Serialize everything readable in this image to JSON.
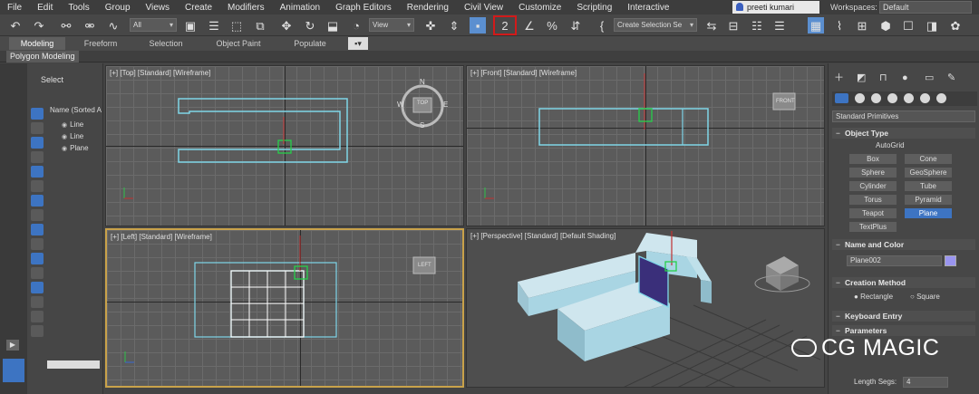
{
  "menu": [
    "File",
    "Edit",
    "Tools",
    "Group",
    "Views",
    "Create",
    "Modifiers",
    "Animation",
    "Graph Editors",
    "Rendering",
    "Civil View",
    "Customize",
    "Scripting",
    "Interactive"
  ],
  "user": "preeti kumari",
  "workspace_label": "Workspaces:",
  "workspace_value": "Default",
  "toolbar": {
    "selection_filter": "All",
    "reference_coord": "View",
    "named_selection": "Create Selection Se"
  },
  "ribbon": {
    "tabs": [
      "Modeling",
      "Freeform",
      "Selection",
      "Object Paint",
      "Populate"
    ],
    "active": "Modeling",
    "sub": "Polygon Modeling"
  },
  "scene_explorer": {
    "title": "Select",
    "column": "Name (Sorted A",
    "rows": [
      "Line",
      "Line",
      "Plane"
    ]
  },
  "viewports": {
    "top": "[+] [Top] [Standard] [Wireframe]",
    "front": "[+] [Front] [Standard] [Wireframe]",
    "left": "[+] [Left] [Standard] [Wireframe]",
    "perspective": "[+] [Perspective] [Standard] [Default Shading]",
    "compass_letters": [
      "N",
      "E",
      "S",
      "W"
    ],
    "viewcube_top": "TOP",
    "viewcube_front": "FRONT",
    "viewcube_left": "LEFT"
  },
  "command_panel": {
    "category": "Standard Primitives",
    "object_type_title": "Object Type",
    "autogrid": "AutoGrid",
    "buttons": [
      "Box",
      "Cone",
      "Sphere",
      "GeoSphere",
      "Cylinder",
      "Tube",
      "Torus",
      "Pyramid",
      "Teapot",
      "Plane",
      "TextPlus"
    ],
    "selected_button": "Plane",
    "name_color_title": "Name and Color",
    "object_name": "Plane002",
    "object_color": "#9a95f0",
    "creation_method_title": "Creation Method",
    "creation_methods": [
      "Rectangle",
      "Square"
    ],
    "keyboard_entry_title": "Keyboard Entry",
    "parameters_title": "Parameters",
    "length_segs_label": "Length Segs:",
    "length_segs_value": "4"
  },
  "watermark": "CG MAGIC",
  "colors": {
    "accent": "#3d74c2",
    "highlight": "#d21a1a",
    "wireframe": "#7fd6e8",
    "solid": "#a9d5e3"
  }
}
